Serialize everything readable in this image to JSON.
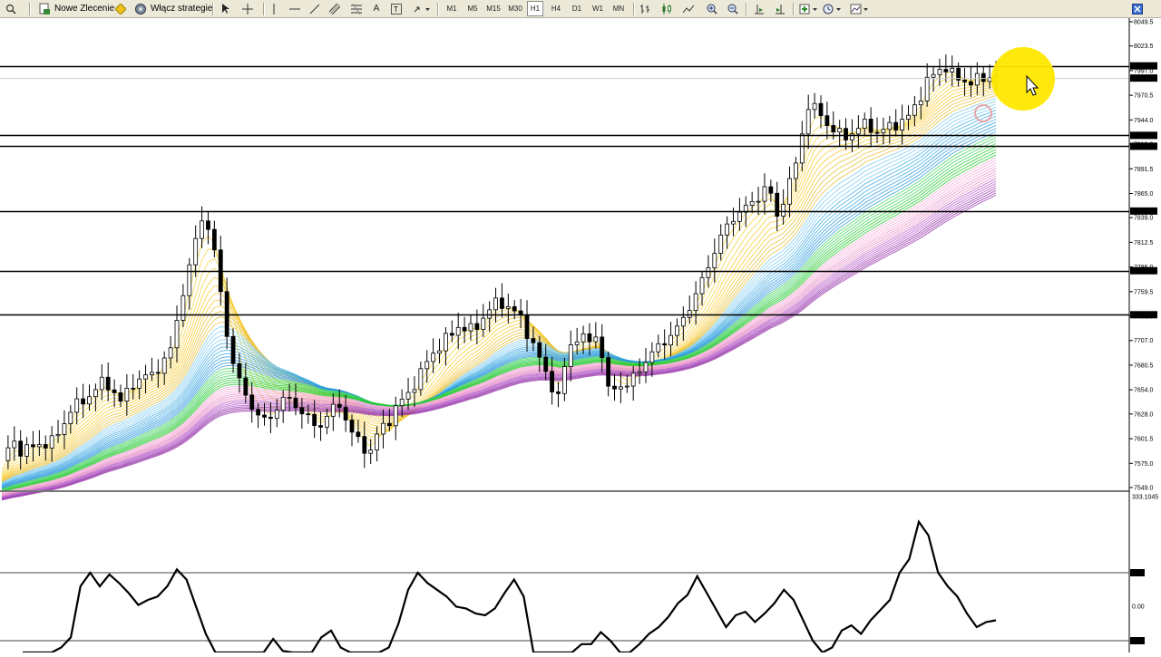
{
  "toolbar": {
    "new_order_label": "Nowe Zlecenie",
    "strategies_label": "Włącz strategie",
    "timeframes": [
      "M1",
      "M5",
      "M15",
      "M30",
      "H1",
      "H4",
      "D1",
      "W1",
      "MN"
    ]
  },
  "price_axis": {
    "labels": [
      "8049.5",
      "8023.5",
      "7997.0",
      "7970.5",
      "7944.0",
      "7918.0",
      "7891.5",
      "7865.0",
      "7839.0",
      "7812.5",
      "7786.0",
      "7759.5",
      "7733.0",
      "7707.0",
      "7680.5",
      "7654.0",
      "7628.0",
      "7601.5",
      "7575.0",
      "7549.0"
    ],
    "level_tags": [
      "8002.1",
      "7989.0",
      "7927.4",
      "7915.7",
      "7846.1",
      "7782.0",
      "7734.7"
    ]
  },
  "indicator_axis": {
    "labels": [
      "333.1045",
      "100",
      "0.00",
      "-100"
    ]
  },
  "colors": {
    "yellow_band": "#f2d23c",
    "blue_band": "#2aa8e0",
    "green_band": "#22cc22",
    "pink_band": "#f0a0d0",
    "purple_band": "#9933aa",
    "cursor_highlight": "#ffe800"
  },
  "chart_data": {
    "type": "line",
    "price_levels": [
      8002.1,
      7927.4,
      7915.7,
      7846.1,
      7782.0,
      7734.7
    ],
    "close_path": [
      7575,
      7600,
      7588,
      7592,
      7596,
      7598,
      7612,
      7635,
      7640,
      7650,
      7662,
      7657,
      7640,
      7660,
      7666,
      7670,
      7680,
      7697,
      7750,
      7790,
      7840,
      7825,
      7760,
      7690,
      7660,
      7640,
      7620,
      7625,
      7640,
      7645,
      7632,
      7620,
      7615,
      7630,
      7640,
      7610,
      7598,
      7585,
      7612,
      7622,
      7640,
      7652,
      7668,
      7690,
      7700,
      7712,
      7723,
      7717,
      7725,
      7740,
      7750,
      7742,
      7735,
      7712,
      7690,
      7665,
      7645,
      7700,
      7712,
      7705,
      7715,
      7652,
      7660,
      7658,
      7675,
      7688,
      7700,
      7710,
      7720,
      7740,
      7760,
      7785,
      7812,
      7830,
      7845,
      7850,
      7860,
      7875,
      7840,
      7870,
      7900,
      7960,
      7955,
      7940,
      7930,
      7925,
      7935,
      7940,
      7930,
      7935,
      7940,
      7945,
      7960,
      7985,
      7995,
      8002,
      7988,
      7985,
      7987,
      7988,
      7994
    ],
    "cci_series": [
      -220,
      -195,
      -170,
      -150,
      -120,
      -90,
      60,
      100,
      60,
      95,
      70,
      40,
      5,
      20,
      30,
      60,
      110,
      80,
      0,
      -80,
      -140,
      -175,
      -190,
      -175,
      -160,
      -140,
      -95,
      -130,
      -190,
      -230,
      -180,
      -90,
      -70,
      -120,
      -180,
      -240,
      -270,
      -210,
      -120,
      -50,
      50,
      100,
      70,
      50,
      30,
      0,
      -5,
      -20,
      -25,
      -5,
      40,
      80,
      30,
      -140,
      -230,
      -270,
      -250,
      -170,
      -110,
      -110,
      -75,
      -100,
      -150,
      -200,
      -110,
      -80,
      -60,
      -30,
      10,
      35,
      90,
      40,
      -10,
      -60,
      -25,
      -15,
      -45,
      -20,
      10,
      50,
      20,
      -40,
      -100,
      -140,
      -120,
      -70,
      -55,
      -80,
      -40,
      -10,
      20,
      100,
      140,
      250,
      210,
      100,
      60,
      30,
      -20,
      -60,
      -45,
      -40
    ]
  }
}
